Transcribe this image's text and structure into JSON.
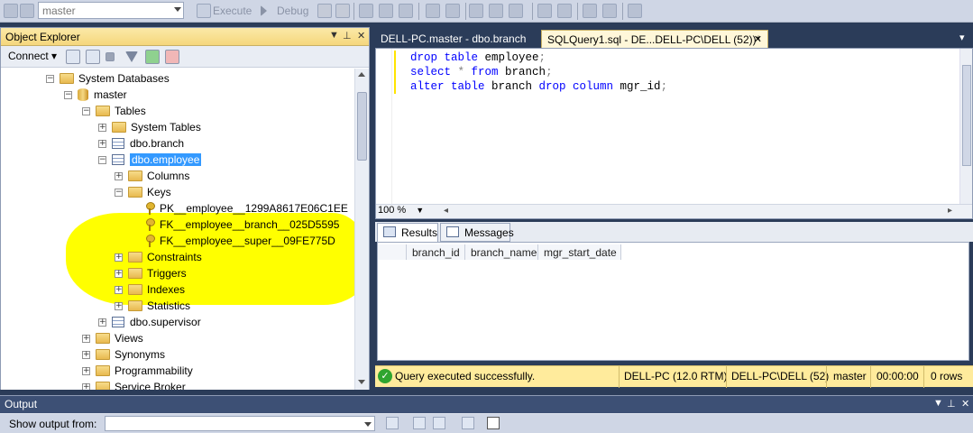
{
  "toolbar": {
    "database_value": "master",
    "execute_label": "Execute",
    "debug_label": "Debug"
  },
  "object_explorer": {
    "title": "Object Explorer",
    "connect_label": "Connect",
    "tree": [
      {
        "label": "System Databases",
        "icon": "folder-icon",
        "expander": "−"
      },
      {
        "label": "master",
        "icon": "database-icon",
        "expander": "−"
      },
      {
        "label": "Tables",
        "icon": "folder-icon",
        "expander": "−"
      },
      {
        "label": "System Tables",
        "icon": "folder-icon",
        "expander": "+"
      },
      {
        "label": "dbo.branch",
        "icon": "table-icon",
        "expander": "+"
      },
      {
        "label": "dbo.employee",
        "icon": "table-icon",
        "expander": "−",
        "selected": true
      },
      {
        "label": "Columns",
        "icon": "folder-icon",
        "expander": "+"
      },
      {
        "label": "Keys",
        "icon": "folder-icon",
        "expander": "−"
      },
      {
        "label": "PK__employee__1299A8617E06C1EE",
        "icon": "key-icon",
        "expander": ""
      },
      {
        "label": "FK__employee__branch__025D5595",
        "icon": "key-icon",
        "expander": ""
      },
      {
        "label": "FK__employee__super__09FE775D",
        "icon": "key-icon",
        "expander": ""
      },
      {
        "label": "Constraints",
        "icon": "folder-icon",
        "expander": "+"
      },
      {
        "label": "Triggers",
        "icon": "folder-icon",
        "expander": "+"
      },
      {
        "label": "Indexes",
        "icon": "folder-icon",
        "expander": "+"
      },
      {
        "label": "Statistics",
        "icon": "folder-icon",
        "expander": "+"
      },
      {
        "label": "dbo.supervisor",
        "icon": "table-icon",
        "expander": "+"
      },
      {
        "label": "Views",
        "icon": "folder-icon",
        "expander": "+"
      },
      {
        "label": "Synonyms",
        "icon": "folder-icon",
        "expander": "+"
      },
      {
        "label": "Programmability",
        "icon": "folder-icon",
        "expander": "+"
      },
      {
        "label": "Service Broker",
        "icon": "folder-icon",
        "expander": "+"
      }
    ]
  },
  "document_tabs": [
    {
      "label": "DELL-PC.master - dbo.branch",
      "active": false
    },
    {
      "label": "SQLQuery1.sql - DE...DELL-PC\\DELL (52))*",
      "active": true
    }
  ],
  "editor": {
    "lines": [
      [
        {
          "t": "drop table",
          "k": "kw"
        },
        {
          "t": " employee",
          "k": ""
        },
        {
          "t": ";",
          "k": "op"
        }
      ],
      [
        {
          "t": "select",
          "k": "kw"
        },
        {
          "t": " * ",
          "k": "op"
        },
        {
          "t": "from",
          "k": "kw"
        },
        {
          "t": " branch",
          "k": ""
        },
        {
          "t": ";",
          "k": "op"
        }
      ],
      [
        {
          "t": "alter table",
          "k": "kw"
        },
        {
          "t": " branch ",
          "k": ""
        },
        {
          "t": "drop column",
          "k": "kw"
        },
        {
          "t": " mgr_id",
          "k": ""
        },
        {
          "t": ";",
          "k": "op"
        }
      ]
    ],
    "zoom": "100 %"
  },
  "results": {
    "tabs": [
      "Results",
      "Messages"
    ],
    "columns": [
      "branch_id",
      "branch_name",
      "mgr_start_date"
    ]
  },
  "status_bar": {
    "message": "Query executed successfully.",
    "server": "DELL-PC (12.0 RTM)",
    "user": "DELL-PC\\DELL (52)",
    "database": "master",
    "elapsed": "00:00:00",
    "rows": "0 rows"
  },
  "output": {
    "title": "Output",
    "show_from_label": "Show output from:"
  }
}
